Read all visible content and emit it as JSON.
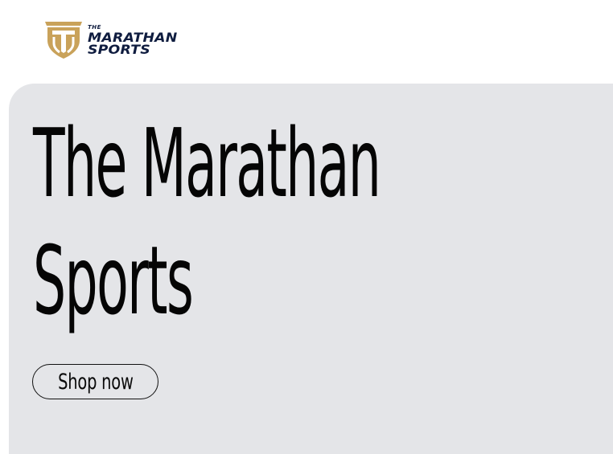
{
  "header": {
    "logo": {
      "small_text": "THE",
      "line1": "MARATHAN",
      "line2": "SPORTS",
      "icon": "shield-monogram-icon",
      "accent_color": "#c9a25a",
      "text_color": "#0f1c3f"
    }
  },
  "hero": {
    "title_line1": "The Marathan",
    "title_line2": "Sports",
    "cta_label": "Shop now",
    "background_color": "#e4e5e8"
  }
}
